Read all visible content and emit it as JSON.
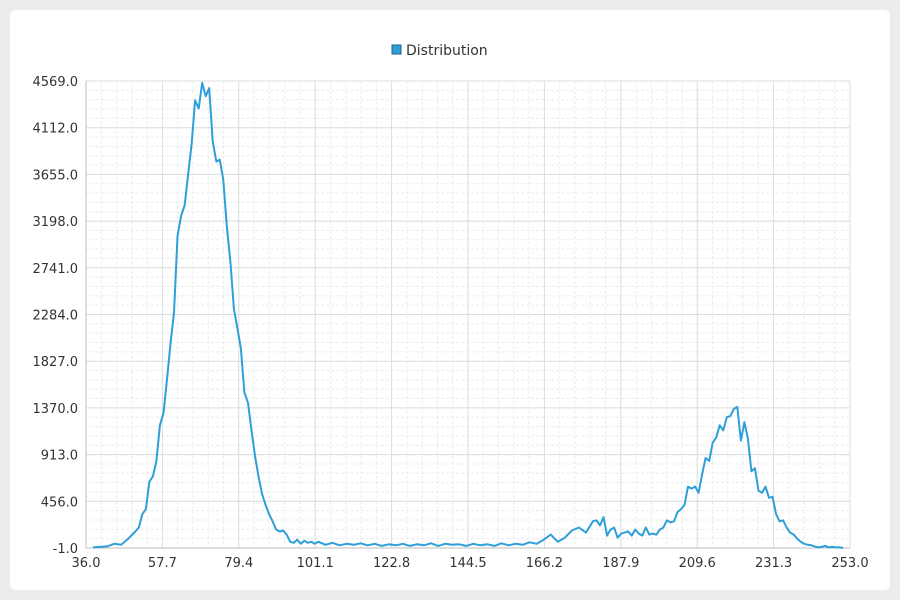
{
  "chart_data": {
    "type": "line",
    "legend": {
      "position": "top-center"
    },
    "grid": true,
    "xlim": [
      36.0,
      253.0
    ],
    "ylim": [
      -1.0,
      4569.0
    ],
    "x_ticks": [
      "36.0",
      "57.7",
      "79.4",
      "101.1",
      "122.8",
      "144.5",
      "166.2",
      "187.9",
      "209.6",
      "231.3",
      "253.0"
    ],
    "y_ticks": [
      "-1.0",
      "456.0",
      "913.0",
      "1370.0",
      "1827.0",
      "2284.0",
      "2741.0",
      "3198.0",
      "3655.0",
      "4112.0",
      "4569.0"
    ],
    "series": [
      {
        "name": "Distribution",
        "color": "#2e9fd8",
        "points": [
          [
            38,
            5
          ],
          [
            40,
            10
          ],
          [
            42,
            15
          ],
          [
            44,
            40
          ],
          [
            46,
            30
          ],
          [
            48,
            90
          ],
          [
            50,
            160
          ],
          [
            51,
            200
          ],
          [
            52,
            330
          ],
          [
            53,
            380
          ],
          [
            54,
            650
          ],
          [
            55,
            700
          ],
          [
            56,
            850
          ],
          [
            57,
            1200
          ],
          [
            58,
            1320
          ],
          [
            59,
            1650
          ],
          [
            60,
            2000
          ],
          [
            61,
            2300
          ],
          [
            62,
            3050
          ],
          [
            63,
            3250
          ],
          [
            64,
            3350
          ],
          [
            65,
            3650
          ],
          [
            66,
            3950
          ],
          [
            67,
            4380
          ],
          [
            68,
            4300
          ],
          [
            69,
            4550
          ],
          [
            70,
            4420
          ],
          [
            71,
            4500
          ],
          [
            72,
            3980
          ],
          [
            73,
            3780
          ],
          [
            74,
            3800
          ],
          [
            75,
            3600
          ],
          [
            76,
            3150
          ],
          [
            77,
            2800
          ],
          [
            78,
            2340
          ],
          [
            79,
            2150
          ],
          [
            80,
            1950
          ],
          [
            81,
            1520
          ],
          [
            82,
            1420
          ],
          [
            83,
            1150
          ],
          [
            84,
            900
          ],
          [
            85,
            700
          ],
          [
            86,
            530
          ],
          [
            87,
            420
          ],
          [
            88,
            330
          ],
          [
            89,
            260
          ],
          [
            90,
            180
          ],
          [
            91,
            160
          ],
          [
            92,
            170
          ],
          [
            93,
            130
          ],
          [
            94,
            60
          ],
          [
            95,
            50
          ],
          [
            96,
            80
          ],
          [
            97,
            40
          ],
          [
            98,
            70
          ],
          [
            99,
            50
          ],
          [
            100,
            60
          ],
          [
            101,
            40
          ],
          [
            102,
            60
          ],
          [
            104,
            30
          ],
          [
            106,
            50
          ],
          [
            108,
            25
          ],
          [
            110,
            40
          ],
          [
            112,
            30
          ],
          [
            114,
            45
          ],
          [
            116,
            25
          ],
          [
            118,
            40
          ],
          [
            120,
            20
          ],
          [
            122,
            35
          ],
          [
            124,
            25
          ],
          [
            126,
            40
          ],
          [
            128,
            20
          ],
          [
            130,
            35
          ],
          [
            132,
            25
          ],
          [
            134,
            45
          ],
          [
            136,
            20
          ],
          [
            138,
            40
          ],
          [
            140,
            30
          ],
          [
            142,
            35
          ],
          [
            144,
            20
          ],
          [
            146,
            40
          ],
          [
            148,
            25
          ],
          [
            150,
            35
          ],
          [
            152,
            20
          ],
          [
            154,
            45
          ],
          [
            156,
            25
          ],
          [
            158,
            40
          ],
          [
            160,
            30
          ],
          [
            162,
            55
          ],
          [
            164,
            40
          ],
          [
            166,
            80
          ],
          [
            168,
            130
          ],
          [
            170,
            60
          ],
          [
            172,
            100
          ],
          [
            174,
            170
          ],
          [
            176,
            200
          ],
          [
            178,
            150
          ],
          [
            180,
            260
          ],
          [
            181,
            270
          ],
          [
            182,
            220
          ],
          [
            183,
            300
          ],
          [
            184,
            120
          ],
          [
            185,
            180
          ],
          [
            186,
            200
          ],
          [
            187,
            100
          ],
          [
            188,
            140
          ],
          [
            189,
            150
          ],
          [
            190,
            160
          ],
          [
            191,
            120
          ],
          [
            192,
            180
          ],
          [
            193,
            140
          ],
          [
            194,
            120
          ],
          [
            195,
            200
          ],
          [
            196,
            130
          ],
          [
            197,
            140
          ],
          [
            198,
            130
          ],
          [
            199,
            180
          ],
          [
            200,
            200
          ],
          [
            201,
            270
          ],
          [
            202,
            250
          ],
          [
            203,
            260
          ],
          [
            204,
            350
          ],
          [
            205,
            380
          ],
          [
            206,
            420
          ],
          [
            207,
            600
          ],
          [
            208,
            580
          ],
          [
            209,
            600
          ],
          [
            210,
            540
          ],
          [
            211,
            720
          ],
          [
            212,
            880
          ],
          [
            213,
            850
          ],
          [
            214,
            1030
          ],
          [
            215,
            1080
          ],
          [
            216,
            1200
          ],
          [
            217,
            1150
          ],
          [
            218,
            1280
          ],
          [
            219,
            1290
          ],
          [
            220,
            1360
          ],
          [
            221,
            1380
          ],
          [
            222,
            1050
          ],
          [
            223,
            1230
          ],
          [
            224,
            1070
          ],
          [
            225,
            750
          ],
          [
            226,
            780
          ],
          [
            227,
            560
          ],
          [
            228,
            540
          ],
          [
            229,
            600
          ],
          [
            230,
            490
          ],
          [
            231,
            500
          ],
          [
            232,
            330
          ],
          [
            233,
            260
          ],
          [
            234,
            270
          ],
          [
            235,
            200
          ],
          [
            236,
            150
          ],
          [
            237,
            130
          ],
          [
            238,
            90
          ],
          [
            239,
            60
          ],
          [
            240,
            40
          ],
          [
            241,
            30
          ],
          [
            242,
            25
          ],
          [
            243,
            15
          ],
          [
            244,
            5
          ],
          [
            245,
            10
          ],
          [
            246,
            20
          ],
          [
            247,
            5
          ],
          [
            248,
            10
          ],
          [
            249,
            5
          ],
          [
            250,
            5
          ],
          [
            251,
            0
          ]
        ]
      }
    ]
  }
}
